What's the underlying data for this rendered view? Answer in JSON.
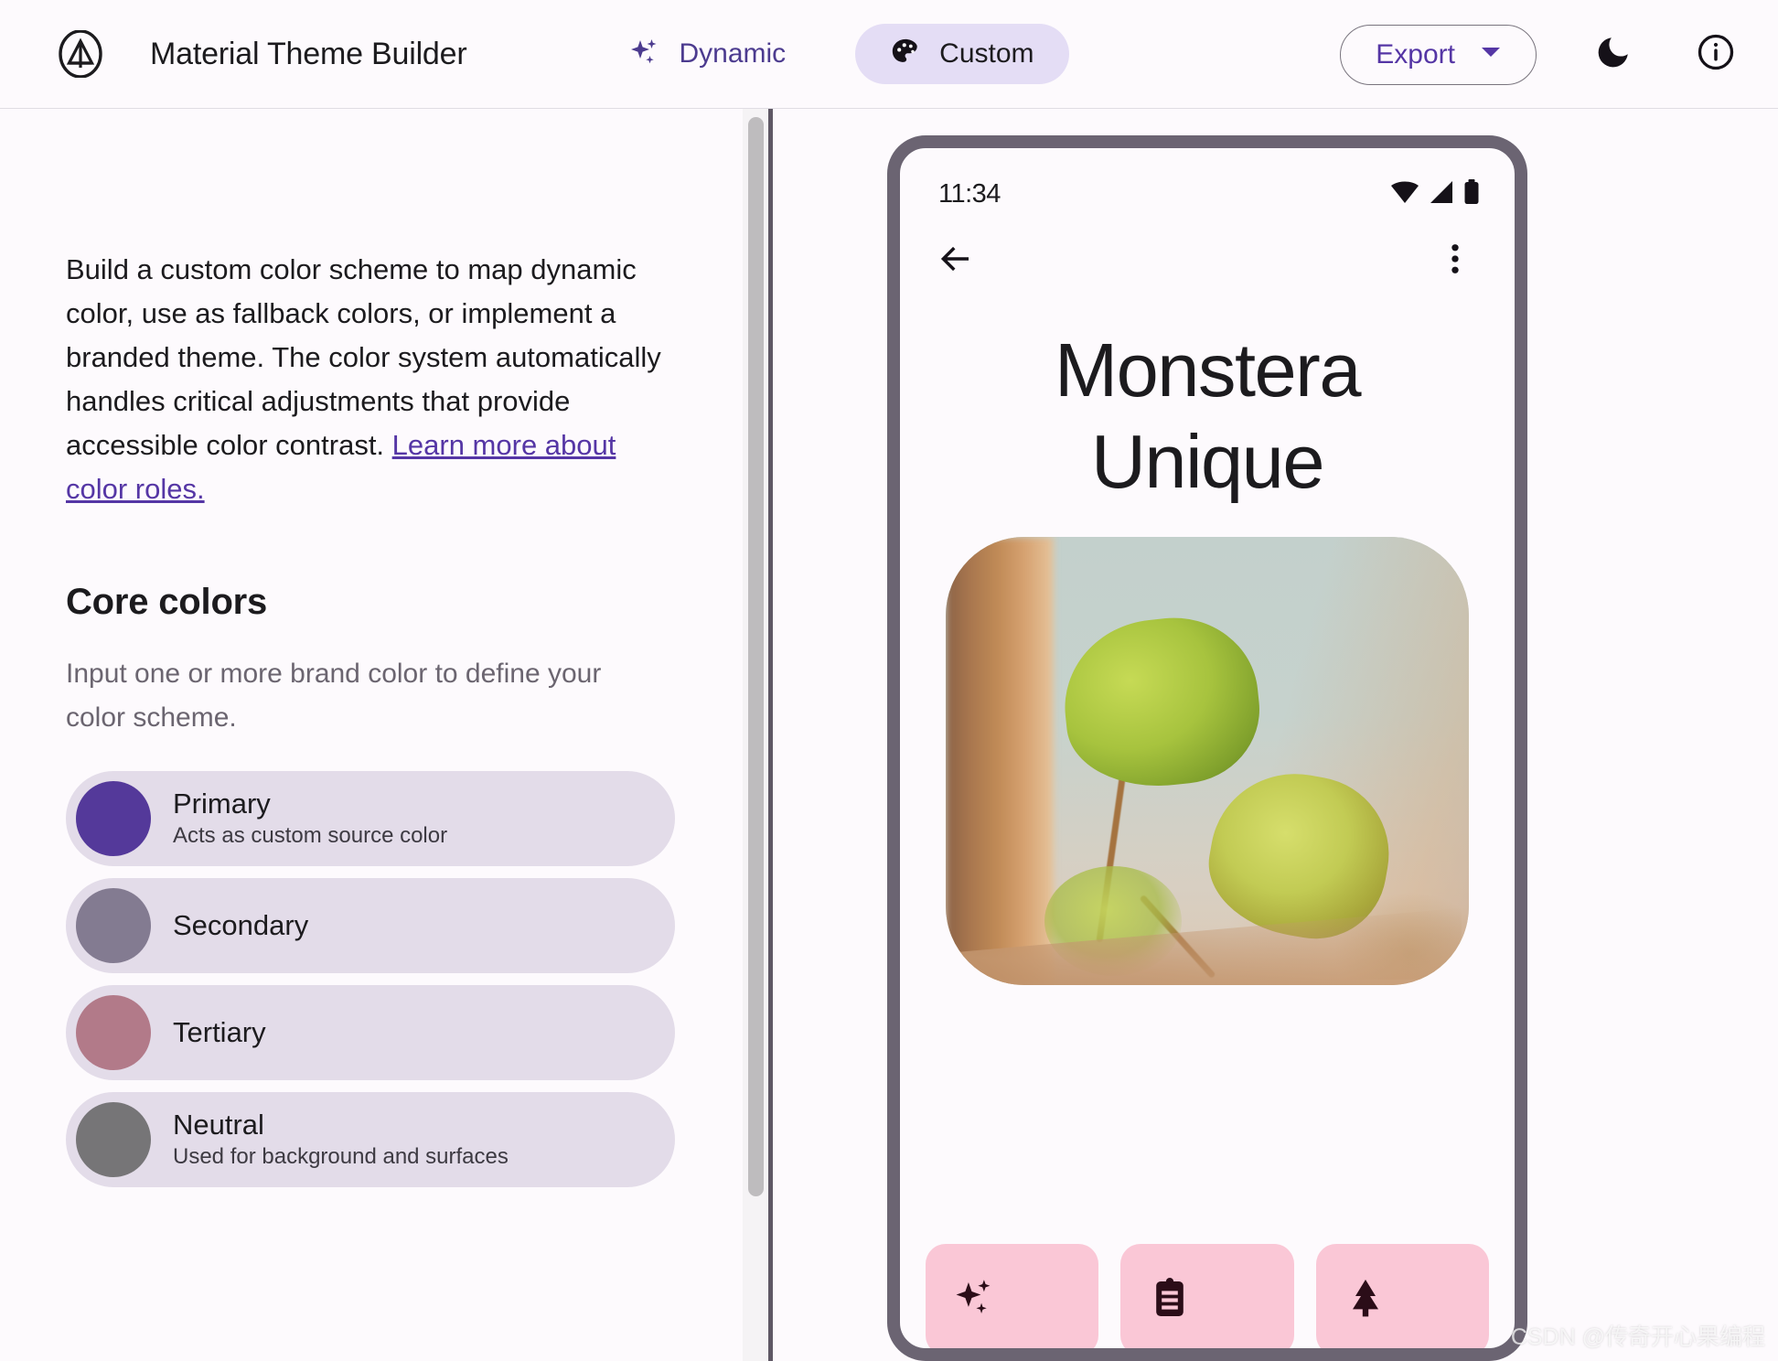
{
  "app": {
    "title": "Material Theme Builder",
    "logo_icon": "material-m-logo-icon"
  },
  "header": {
    "segments": [
      {
        "label": "Dynamic",
        "icon": "sparkle-icon",
        "active": false
      },
      {
        "label": "Custom",
        "icon": "palette-icon",
        "active": true
      }
    ],
    "export": {
      "label": "Export",
      "icon": "chevron-down-icon"
    },
    "dark_mode_icon": "moon-icon",
    "info_icon": "info-circle-icon"
  },
  "left": {
    "intro_text": "Build a custom color scheme to map dynamic color, use as fallback colors, or implement a branded theme. The color system automatically handles critical adjustments that provide accessible color contrast. ",
    "intro_link": "Learn more about color roles.",
    "section_title": "Core colors",
    "section_subtitle": "Input one or more brand color to define your color scheme.",
    "swatches": [
      {
        "name": "Primary",
        "desc": "Acts as custom source color",
        "color": "#54399A"
      },
      {
        "name": "Secondary",
        "desc": "",
        "color": "#837B91"
      },
      {
        "name": "Tertiary",
        "desc": "",
        "color": "#B27A89"
      },
      {
        "name": "Neutral",
        "desc": "Used for background and surfaces",
        "color": "#767577"
      }
    ]
  },
  "phone": {
    "status": {
      "time": "11:34",
      "wifi_icon": "wifi-icon",
      "signal_icon": "cell-signal-icon",
      "battery_icon": "battery-icon"
    },
    "toolbar": {
      "back_icon": "arrow-back-icon",
      "overflow_icon": "more-vert-icon"
    },
    "title_line1": "Monstera",
    "title_line2": "Unique",
    "hero_image_alt": "monstera-plant-on-windowsill-photo",
    "cards": [
      {
        "icon": "sparkle-icon"
      },
      {
        "icon": "clipboard-icon"
      },
      {
        "icon": "park-tree-icon"
      }
    ]
  },
  "watermark": "CSDN @传奇开心果编程",
  "colors": {
    "accent": "#5536A5",
    "segment_active_bg": "#E4DDF5",
    "swatch_row_bg": "#E3DCE9",
    "card_bg": "#FAC7D6",
    "phone_frame": "#6B6472",
    "divider": "#5F5865",
    "surface": "#FDFAFD"
  }
}
